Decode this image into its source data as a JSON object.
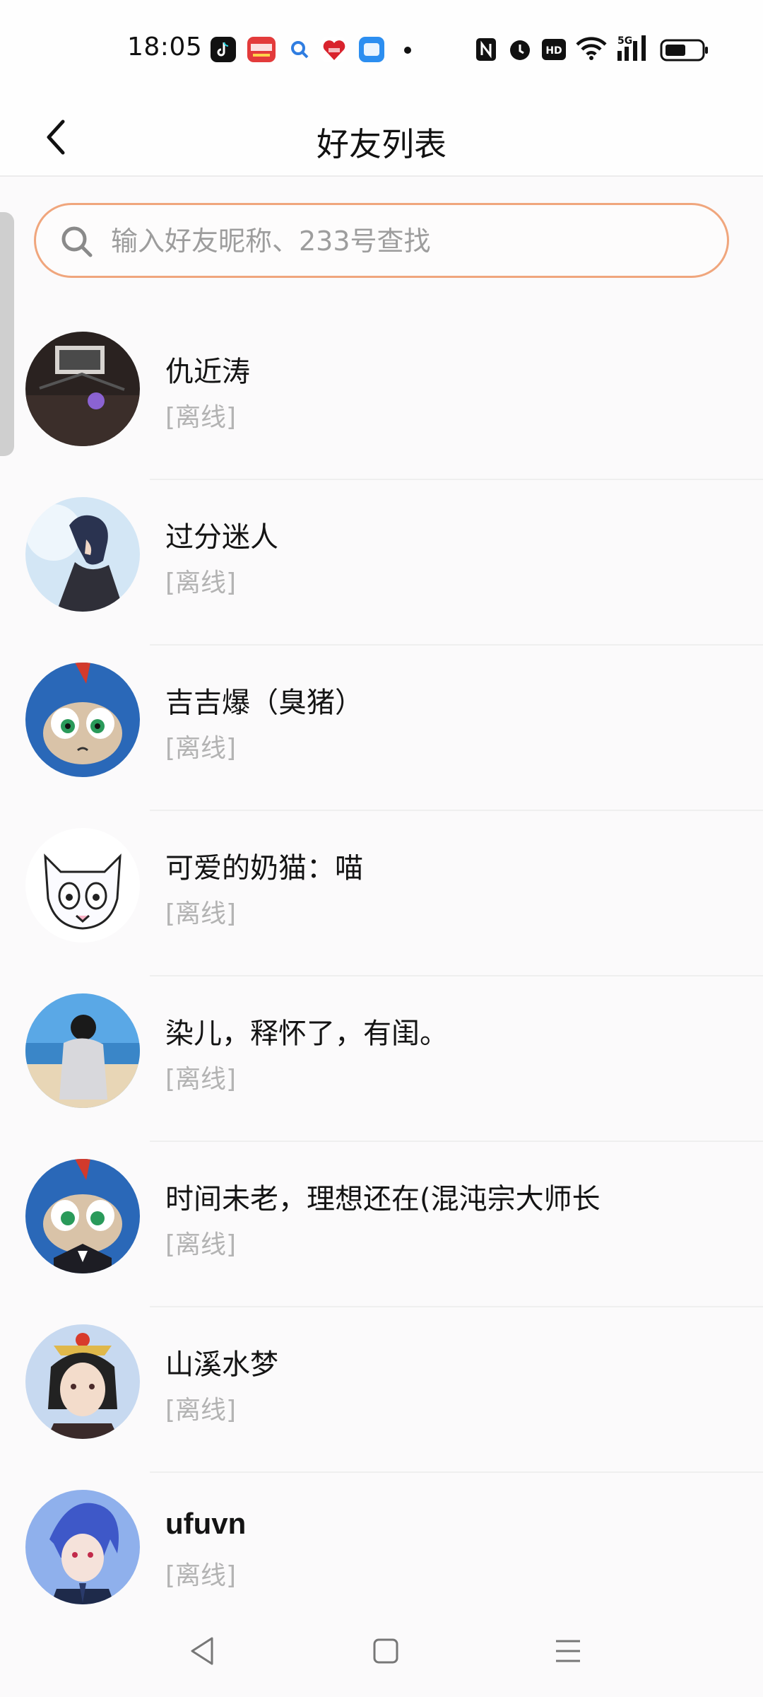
{
  "status_bar": {
    "time": "18:05",
    "apps": [
      "douyin-icon",
      "toutiao-icon",
      "search-app-icon",
      "shopping-618-icon",
      "message-app-icon"
    ],
    "indicators": [
      "nfc-icon",
      "alarm-icon",
      "hd-icon",
      "wifi-icon",
      "5g-signal-icon",
      "battery-icon"
    ],
    "network": "5G"
  },
  "header": {
    "title": "好友列表"
  },
  "search": {
    "placeholder": "输入好友昵称、233号查找",
    "value": ""
  },
  "friends": [
    {
      "name": "仇近涛",
      "status": "[离线]"
    },
    {
      "name": "过分迷人",
      "status": "[离线]"
    },
    {
      "name": "吉吉爆（臭猪）",
      "status": "[离线]"
    },
    {
      "name": "可爱的奶猫：喵",
      "status": "[离线]"
    },
    {
      "name": "染儿，释怀了，有闺。",
      "status": "[离线]"
    },
    {
      "name": "时间未老，理想还在(混沌宗大师长",
      "status": "[离线]"
    },
    {
      "name": "山溪水梦",
      "status": "[离线]"
    },
    {
      "name": "ufuvn",
      "status": "[离线]"
    }
  ],
  "colors": {
    "accent": "#f0a67d",
    "status_text": "#b3b3b3",
    "background": "#fbfafb"
  }
}
